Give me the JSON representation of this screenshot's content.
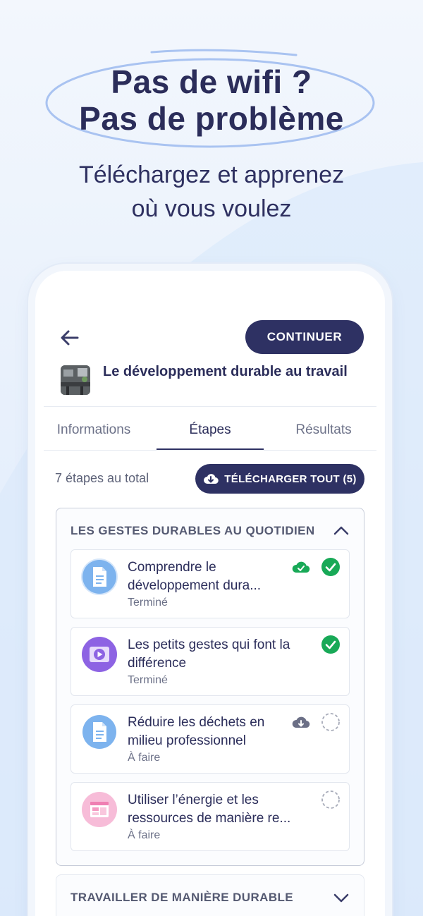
{
  "hero": {
    "title_line1": "Pas de wifi ?",
    "title_line2": "Pas de problème",
    "subtitle_line1": "Téléchargez et apprenez",
    "subtitle_line2": "où vous voulez"
  },
  "header": {
    "continue_label": "CONTINUER",
    "course_title": "Le développement durable au travail"
  },
  "tabs": [
    {
      "label": "Informations",
      "active": false
    },
    {
      "label": "Étapes",
      "active": true
    },
    {
      "label": "Résultats",
      "active": false
    }
  ],
  "steps_bar": {
    "count_text": "7 étapes au total",
    "download_all_label": "TÉLÉCHARGER TOUT (5)"
  },
  "sections": [
    {
      "title": "LES GESTES DURABLES AU QUOTIDIEN",
      "expanded": true,
      "items": [
        {
          "title": "Comprendre le développement dura...",
          "status": "Terminé",
          "icon": "document-icon",
          "downloaded": true,
          "done": true
        },
        {
          "title": "Les petits gestes qui font la différence",
          "status": "Terminé",
          "icon": "video-icon",
          "downloaded": null,
          "done": true
        },
        {
          "title": "Réduire les déchets en milieu professionnel",
          "status": "À faire",
          "icon": "document-icon",
          "downloaded": false,
          "done": false
        },
        {
          "title": "Utiliser l’énergie et les ressources de manière re...",
          "status": "À faire",
          "icon": "webpage-icon",
          "downloaded": null,
          "done": false
        }
      ]
    },
    {
      "title": "TRAVAILLER DE MANIÈRE DURABLE",
      "expanded": false
    }
  ],
  "colors": {
    "navy": "#2e3163",
    "success": "#18a957",
    "doc_blue": "#6fa9e8",
    "video_purple": "#8b5fe0",
    "web_pink": "#ef7fb2"
  }
}
